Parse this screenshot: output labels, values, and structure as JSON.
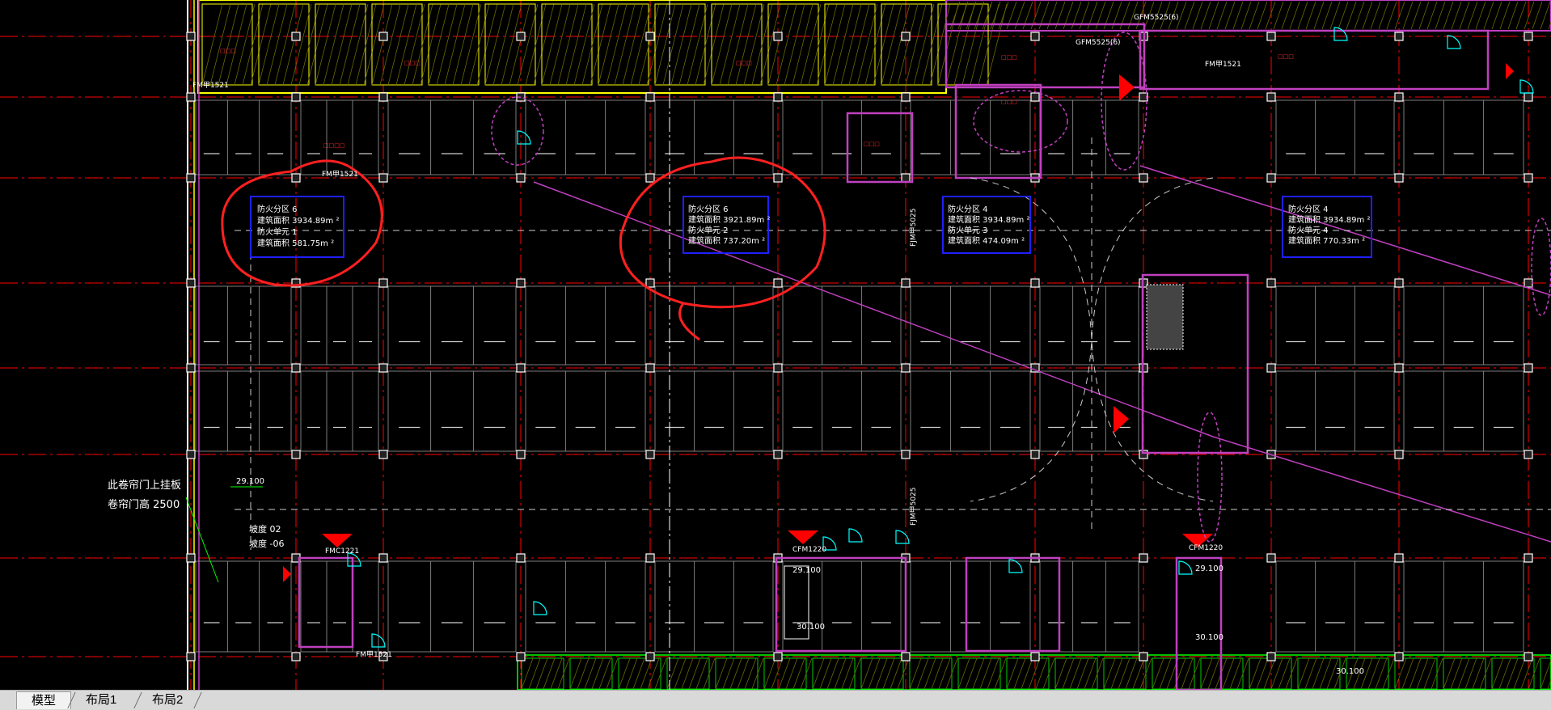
{
  "tabs": [
    {
      "label": "模型",
      "active": true
    },
    {
      "label": "布局1",
      "active": false
    },
    {
      "label": "布局2",
      "active": false
    }
  ],
  "zones": [
    {
      "lines": [
        "防火分区 6",
        "建筑面积 3934.89m ²",
        "防火单元 1",
        "建筑面积 581.75m ²"
      ]
    },
    {
      "lines": [
        "防火分区 6",
        "建筑面积 3921.89m ²",
        "防火单元 2",
        "建筑面积 737.20m ²"
      ]
    },
    {
      "lines": [
        "防火分区 4",
        "建筑面积 3934.89m ²",
        "防火单元 3",
        "建筑面积 474.09m ²"
      ]
    },
    {
      "lines": [
        "防火分区 4",
        "建筑面积 3934.89m ²",
        "防火单元 4",
        "建筑面积 770.33m ²"
      ]
    }
  ],
  "annotations": {
    "shutter_note_1": "此卷帘门上挂板",
    "shutter_note_2": "卷帘门高 2500",
    "slope_1": "坡度 02",
    "slope_2": "坡度 -06",
    "elev_1": "29.100",
    "elev_2": "29.100",
    "elev_3": "30.100",
    "elev_4": "29.100",
    "elev_5": "30.100",
    "elev_6": "30.100"
  },
  "door_labels": {
    "fmb_1": "FM甲1521",
    "fmb_2": "FM甲1521",
    "fmb_3": "FM甲1521",
    "fmb_4": "FM甲1521",
    "fmc_1": "FMC1221",
    "cfm_1": "CFM1220",
    "cfm_2": "CFM1220",
    "fjm_1": "FJM甲5025",
    "fjm_2": "FJM甲5025",
    "gfm_1": "GFM5525(6)",
    "gfm_2": "GFM5525(6)"
  },
  "colors": {
    "grid": "#ff0000",
    "column": "#ffffff",
    "wall": "#c040c0",
    "hatch": "#ffff00",
    "annotation": "#ff0000",
    "zone_box": "#2020ff",
    "cyan": "#00ffff",
    "tab_bar": "#d9d9d9"
  }
}
